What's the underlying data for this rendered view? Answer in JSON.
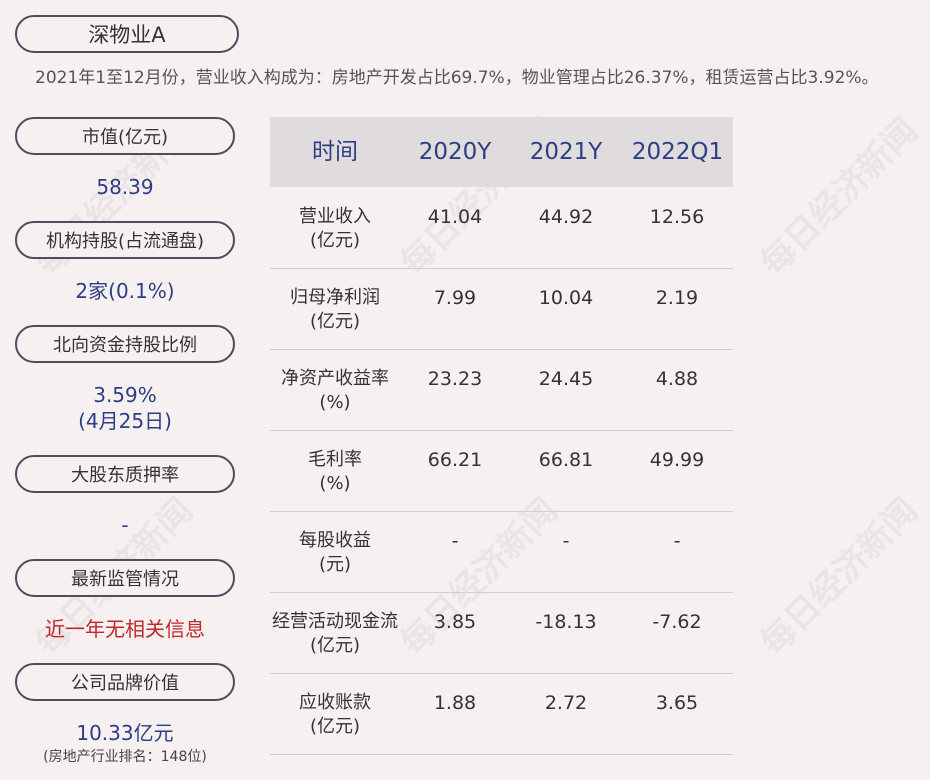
{
  "header": {
    "stock_name": "深物业A",
    "summary": "2021年1至12月份，营业收入构成为：房地产开发占比69.7%，物业管理占比26.37%，租赁运营占比3.92%。"
  },
  "left_panel": {
    "market_cap": {
      "label": "市值(亿元)",
      "value": "58.39"
    },
    "institutional": {
      "label": "机构持股(占流通盘)",
      "value": "2家(0.1%)"
    },
    "northbound": {
      "label": "北向资金持股比例",
      "value_line1": "3.59%",
      "value_line2": "(4月25日)"
    },
    "pledge": {
      "label": "大股东质押率",
      "value": "-"
    },
    "regulation": {
      "label": "最新监管情况",
      "value": "近一年无相关信息"
    },
    "brand": {
      "label": "公司品牌价值",
      "value": "10.33亿元",
      "note": "(房地产行业排名：148位)"
    }
  },
  "table": {
    "headers": [
      "时间",
      "2020Y",
      "2021Y",
      "2022Q1"
    ],
    "rows": [
      {
        "label1": "营业收入",
        "label2": "(亿元)",
        "values": [
          "41.04",
          "44.92",
          "12.56"
        ]
      },
      {
        "label1": "归母净利润",
        "label2": "(亿元)",
        "values": [
          "7.99",
          "10.04",
          "2.19"
        ]
      },
      {
        "label1": "净资产收益率",
        "label2": "(%)",
        "values": [
          "23.23",
          "24.45",
          "4.88"
        ]
      },
      {
        "label1": "毛利率",
        "label2": "(%)",
        "values": [
          "66.21",
          "66.81",
          "49.99"
        ]
      },
      {
        "label1": "每股收益",
        "label2": "(元)",
        "values": [
          "-",
          "-",
          "-"
        ]
      },
      {
        "label1": "经营活动现金流",
        "label2": "(亿元)",
        "values": [
          "3.85",
          "-18.13",
          "-7.62"
        ]
      },
      {
        "label1": "应收账款",
        "label2": "(亿元)",
        "values": [
          "1.88",
          "2.72",
          "3.65"
        ]
      }
    ]
  },
  "watermark": "每日经济新闻",
  "colors": {
    "background": "#f7f0f1",
    "accent": "#2c3e84",
    "alert": "#c0282b",
    "header_bg": "#e0dcdd"
  }
}
